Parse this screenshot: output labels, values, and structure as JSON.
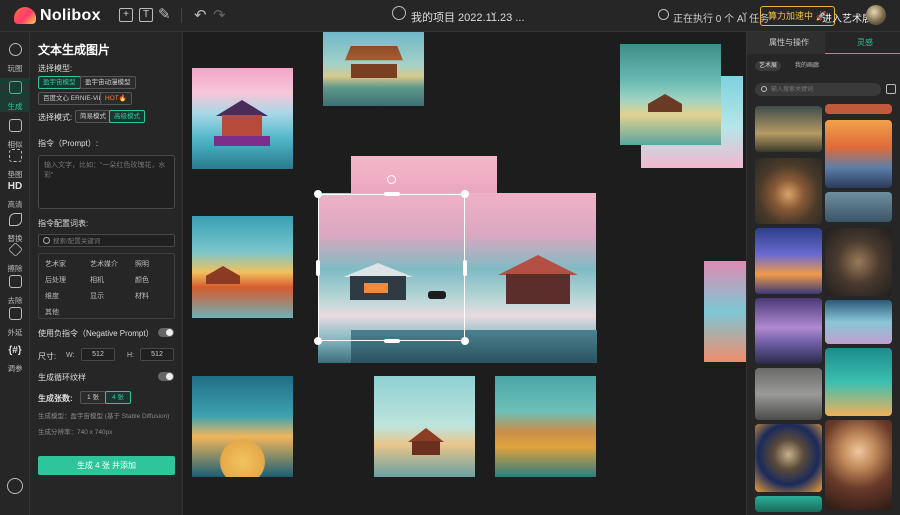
{
  "header": {
    "brand": "Nolibox",
    "project": "我的项目 2022.11.23 ...",
    "task_status": "正在执行 0 个 AI 任务",
    "speed_button": "算力加速中 🚀",
    "gallery_link": "进入艺术展",
    "toolbar_glyphs": {
      "text": "T",
      "undo": "↶",
      "redo": "↷",
      "dropdown": "⌄"
    }
  },
  "rail": {
    "items": [
      {
        "label": "玩图",
        "icon": "grid-icon"
      },
      {
        "label": "生成",
        "icon": "paint-icon"
      },
      {
        "label": "相似",
        "icon": "copy-icon"
      },
      {
        "label": "垫图",
        "icon": "expand-icon"
      },
      {
        "label": "高清",
        "icon": "hd-icon",
        "glyph": "HD"
      },
      {
        "label": "替换",
        "icon": "brush-icon"
      },
      {
        "label": "擦除",
        "icon": "eraser-icon"
      },
      {
        "label": "去除",
        "icon": "remove-icon"
      },
      {
        "label": "外延",
        "icon": "outpaint-icon"
      },
      {
        "label": "调参",
        "icon": "params-icon",
        "glyph": "{#}"
      }
    ]
  },
  "panel": {
    "title": "文本生成图片",
    "model_label": "选择模型:",
    "models": [
      "盈宇宙模型",
      "盈宇宙动漫模型",
      "百度文心 ERNIE-ViLG",
      "HOT🔥"
    ],
    "mode_label": "选择模式:",
    "modes": [
      "简易模式",
      "高级模式"
    ],
    "prompt_label": "指令（Prompt）:",
    "prompt_placeholder": "输入文字，比如：“一朵红色玫瑰花，水彩”",
    "dict_label": "指令配置词表:",
    "dict_search_placeholder": "搜索/配置关键词",
    "categories": [
      "艺术家",
      "艺术媒介",
      "照明",
      "后处理",
      "相机",
      "颜色",
      "维度",
      "显示",
      "材料",
      "其他"
    ],
    "negative_label": "使用负指令（Negative Prompt）",
    "size_label": "尺寸:",
    "w_label": "W:",
    "h_label": "H:",
    "width": "512",
    "height": "512",
    "loop_label": "生成循环纹样",
    "count_label": "生成张数:",
    "count_options": [
      "1 张",
      "4 张"
    ],
    "model_info": "生成模型：盈宇宙模型 (基于 Stable Diffusion)",
    "resolution_info": "生成分辨率：740 x 740px",
    "generate_button": "生成 4 张 并添加"
  },
  "right_panel": {
    "tabs": [
      "属性与操作",
      "灵感"
    ],
    "subtabs": [
      "艺术展",
      "我的画廊"
    ],
    "search_placeholder": "输入搜索关键词"
  },
  "colors": {
    "accent": "#2ec59a",
    "speed": "#f4c54b",
    "background": "#1d1d1d"
  }
}
